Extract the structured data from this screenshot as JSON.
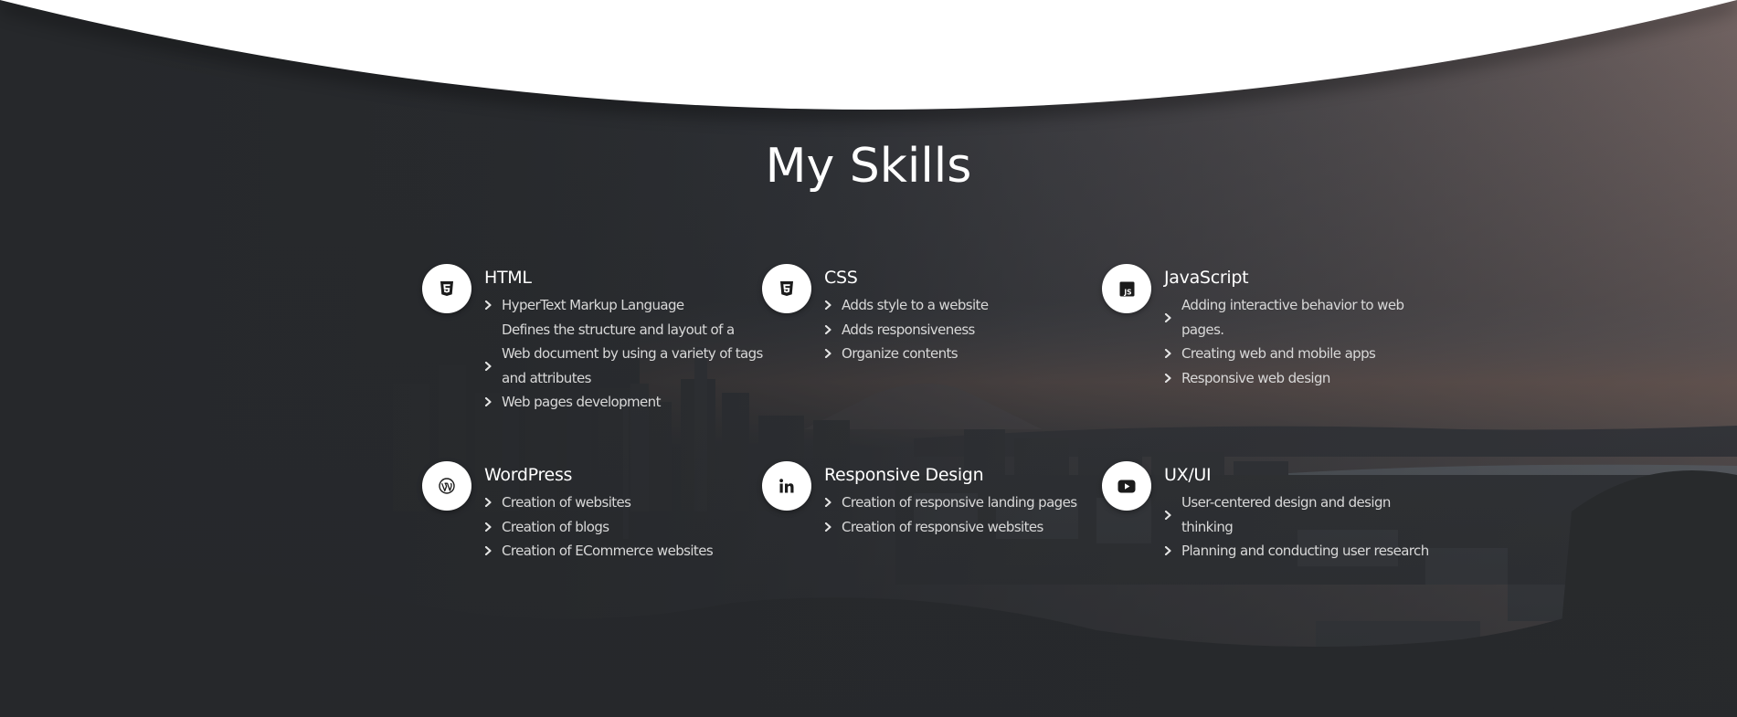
{
  "section": {
    "title": "My Skills"
  },
  "colors": {
    "overlay": "#26282b",
    "sky_warm": "#b0806a",
    "water": "#9aa9b3",
    "icon_bg": "#ffffff"
  },
  "skills": [
    {
      "icon": "html5-icon",
      "title": "HTML",
      "items": [
        {
          "lines": [
            "HyperText Markup Language",
            "Defines the structure and layout of a"
          ]
        },
        {
          "lines": [
            "Web document by using a variety of tags",
            "and attributes"
          ]
        },
        {
          "lines": [
            "Web pages development"
          ]
        }
      ]
    },
    {
      "icon": "css3-icon",
      "title": "CSS",
      "items": [
        {
          "lines": [
            "Adds style to a website"
          ]
        },
        {
          "lines": [
            "Adds responsiveness"
          ]
        },
        {
          "lines": [
            "Organize contents"
          ]
        }
      ]
    },
    {
      "icon": "javascript-icon",
      "title": "JavaScript",
      "items": [
        {
          "lines": [
            "Adding interactive behavior to web",
            "pages."
          ]
        },
        {
          "lines": [
            "Creating web and mobile apps"
          ]
        },
        {
          "lines": [
            "Responsive web design"
          ]
        }
      ]
    },
    {
      "icon": "wordpress-icon",
      "title": "WordPress",
      "items": [
        {
          "lines": [
            "Creation of websites"
          ]
        },
        {
          "lines": [
            "Creation of blogs"
          ]
        },
        {
          "lines": [
            "Creation of ECommerce websites"
          ]
        }
      ]
    },
    {
      "icon": "linkedin-icon",
      "title": "Responsive Design",
      "items": [
        {
          "lines": [
            "Creation of responsive landing pages"
          ]
        },
        {
          "lines": [
            "Creation of responsive websites"
          ]
        }
      ]
    },
    {
      "icon": "youtube-icon",
      "title": "UX/UI",
      "items": [
        {
          "lines": [
            "User-centered design and design",
            "thinking"
          ]
        },
        {
          "lines": [
            "Planning and conducting user research"
          ]
        }
      ]
    }
  ]
}
